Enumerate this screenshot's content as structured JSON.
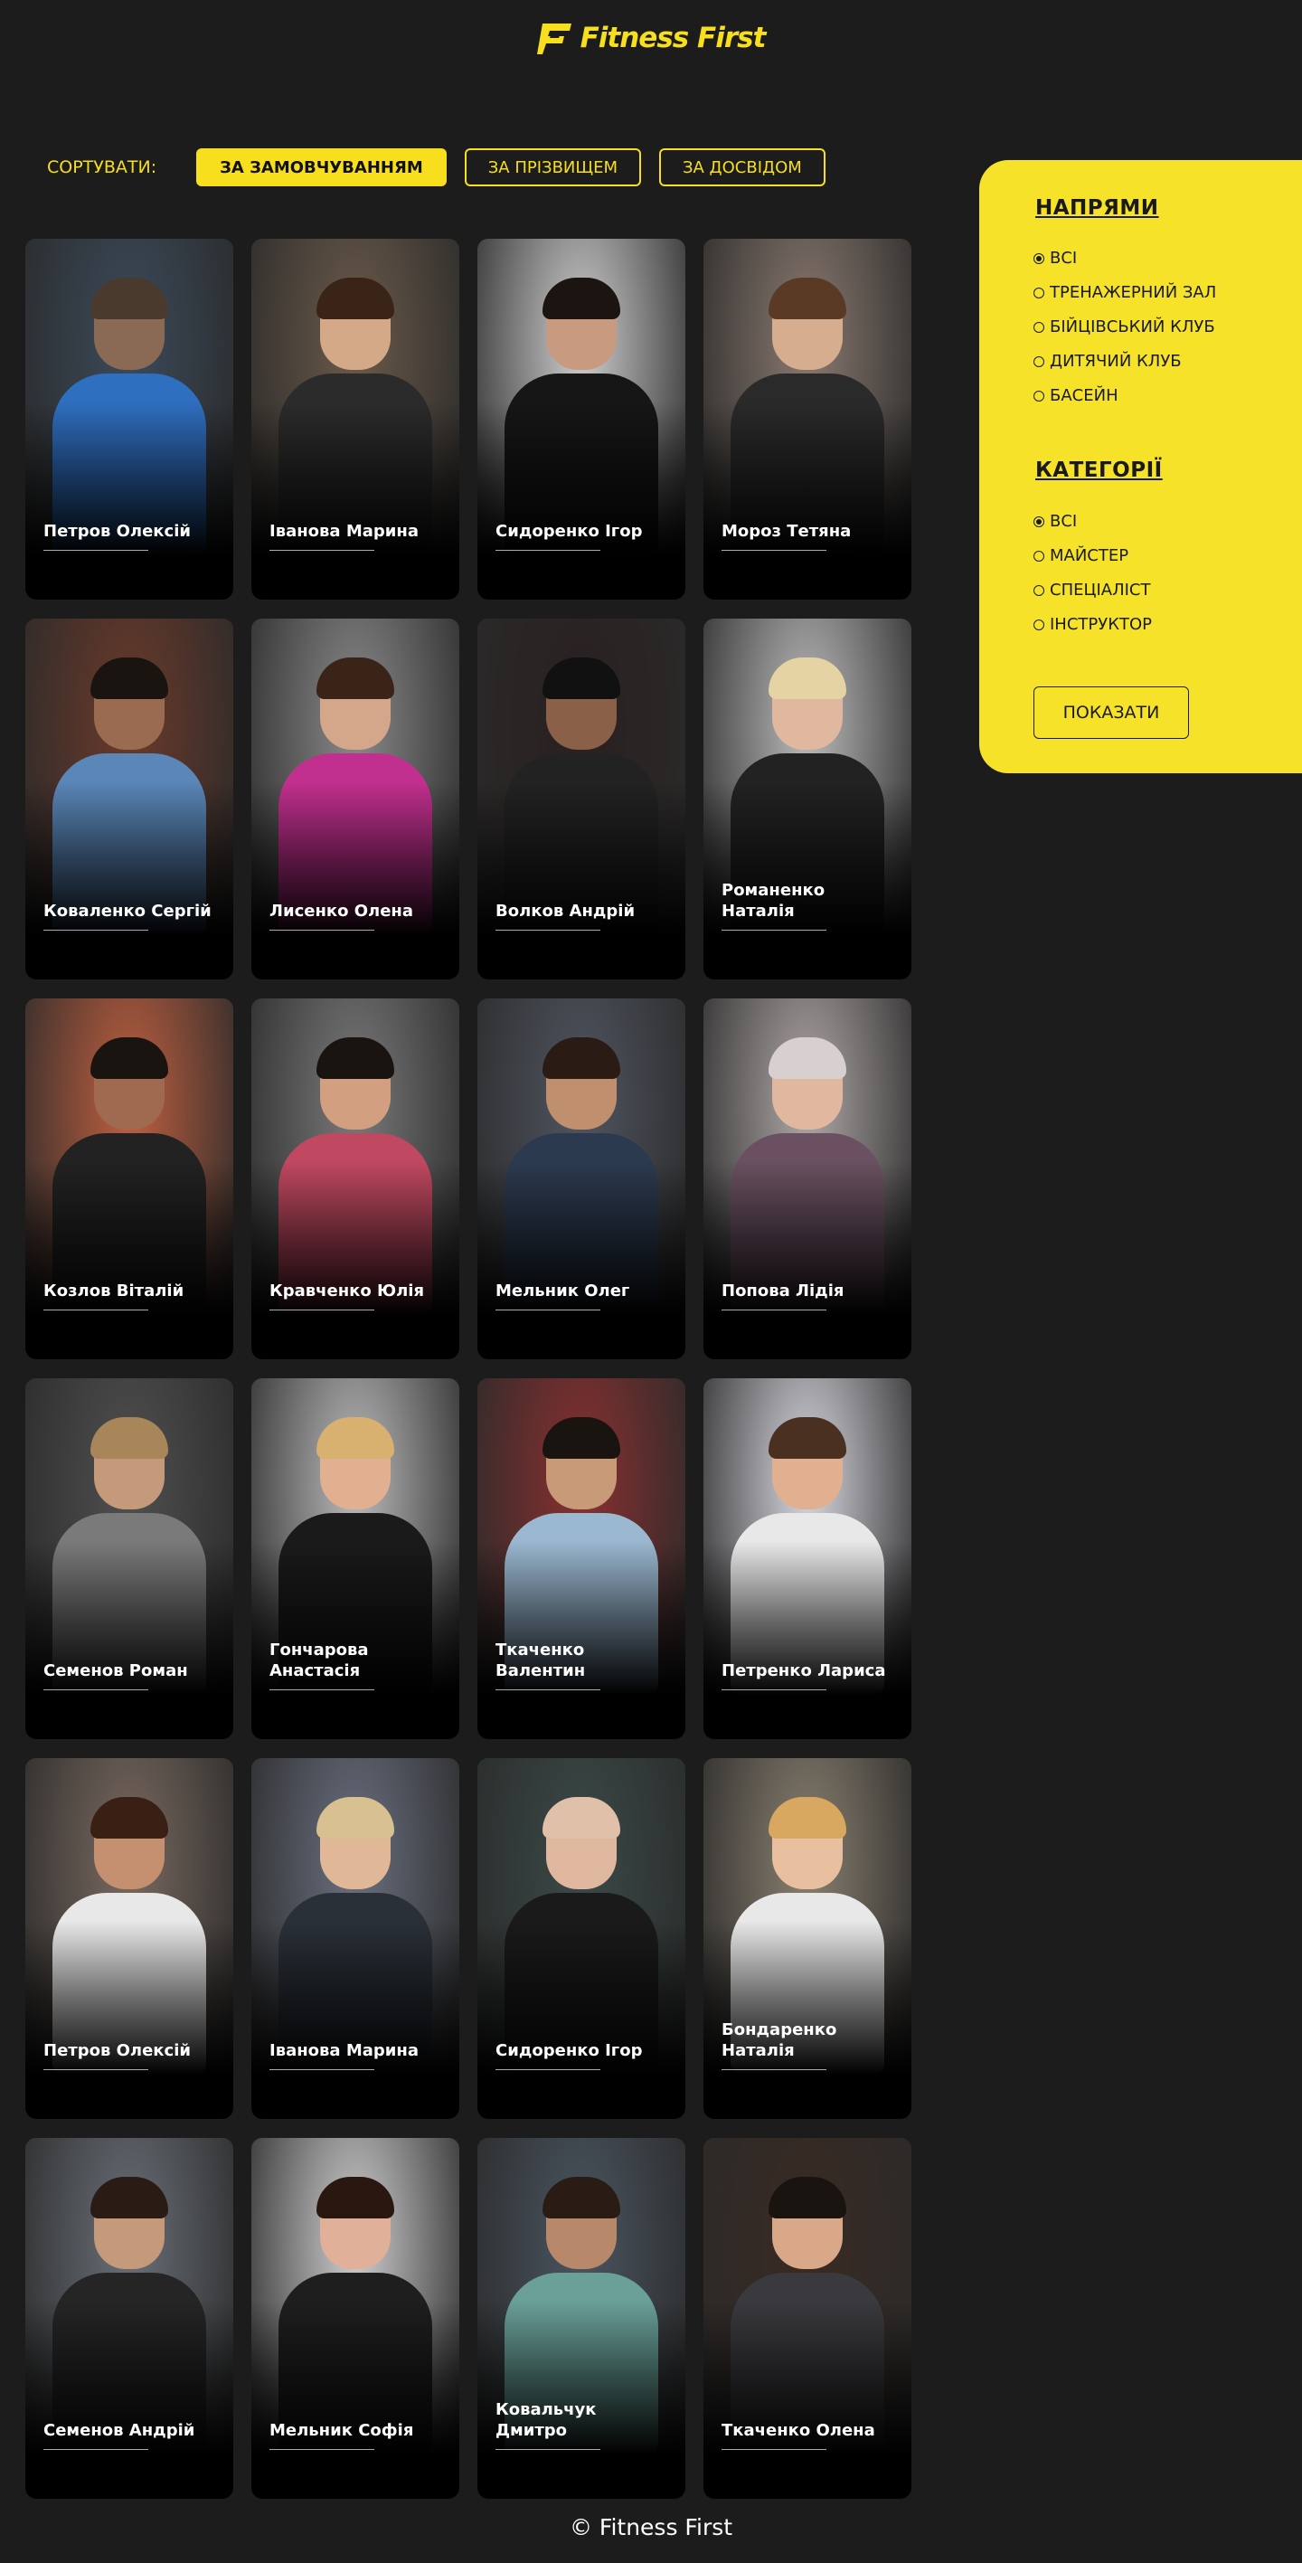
{
  "header": {
    "brand": "Fitness First"
  },
  "sort": {
    "label": "СОРТУВАТИ:",
    "options": [
      "ЗА ЗАМОВЧУВАННЯМ",
      "ЗА ПРІЗВИЩЕМ",
      "ЗА ДОСВІДОМ"
    ],
    "active_index": 0
  },
  "trainers": [
    "Петров Олексій",
    "Іванова Марина",
    "Сидоренко Ігор",
    "Мороз Тетяна",
    "Коваленко Сергій",
    "Лисенко Олена",
    "Волков Андрій",
    "Романенко Наталія",
    "Козлов Віталій",
    "Кравченко Юлія",
    "Мельник Олег",
    "Попова Лідія",
    "Семенов Роман",
    "Гончарова Анастасія",
    "Ткаченко Валентин",
    "Петренко Лариса",
    "Петров Олексій",
    "Іванова Марина",
    "Сидоренко Ігор",
    "Бондаренко Наталія",
    "Семенов Андрій",
    "Мельник Софія",
    "Ковальчук Дмитро",
    "Ткаченко Олена"
  ],
  "filters": {
    "directions_title": "НАПРЯМИ",
    "directions": [
      "ВСІ",
      "ТРЕНАЖЕРНИЙ ЗАЛ",
      "БІЙЦІВСЬКИЙ КЛУБ",
      "ДИТЯЧИЙ КЛУБ",
      "БАСЕЙН"
    ],
    "directions_selected": 0,
    "categories_title": "КАТЕГОРІЇ",
    "categories": [
      "ВСІ",
      "МАЙСТЕР",
      "СПЕЦІАЛІСТ",
      "ІНСТРУКТОР"
    ],
    "categories_selected": 0,
    "show_label": "ПОКАЗАТИ"
  },
  "footer": {
    "text": "© Fitness First"
  },
  "colors": {
    "accent": "#f7df1e",
    "background": "#1c1c1c"
  }
}
